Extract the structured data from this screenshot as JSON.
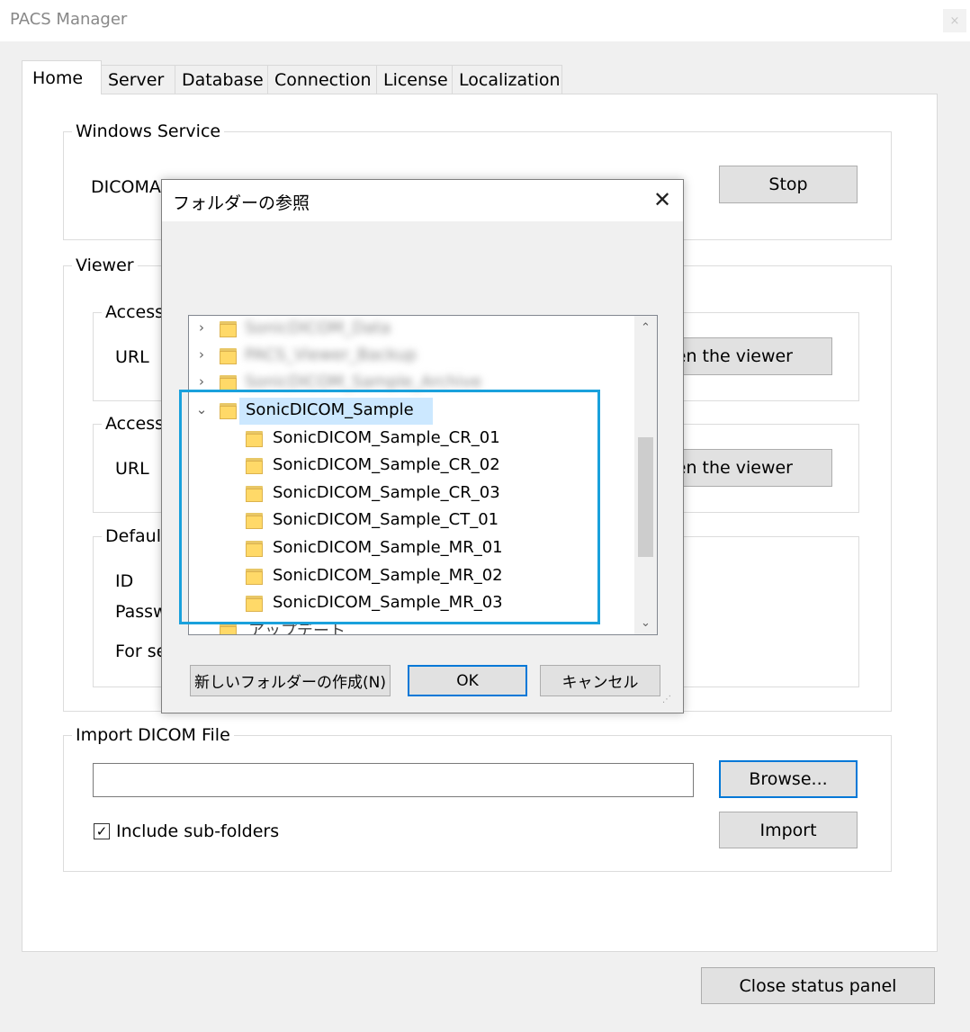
{
  "window": {
    "title": "PACS Manager",
    "close_glyph": "×"
  },
  "tabs": [
    {
      "label": "Home",
      "active": true
    },
    {
      "label": "Server"
    },
    {
      "label": "Database"
    },
    {
      "label": "Connection"
    },
    {
      "label": "License"
    },
    {
      "label": "Localization"
    }
  ],
  "windows_service": {
    "legend": "Windows Service",
    "status_text": "DICOMA",
    "stop_button": "Stop"
  },
  "viewer": {
    "legend": "Viewer",
    "access1": {
      "legend": "Access",
      "url_label": "URL",
      "open_button": "en the viewer"
    },
    "access2": {
      "legend": "Access",
      "url_label": "URL",
      "open_button": "en the viewer"
    },
    "defaults": {
      "legend": "Default",
      "id_label": "ID",
      "password_label": "Passw",
      "for_label": "For se"
    }
  },
  "import": {
    "legend": "Import DICOM File",
    "path_value": "",
    "browse_button": "Browse...",
    "include_subfolders_label": "Include sub-folders",
    "include_subfolders_checked": true,
    "check_glyph": "✓",
    "import_button": "Import"
  },
  "close_status_button": "Close status panel",
  "dialog": {
    "title": "フォルダーの参照",
    "close_glyph": "✕",
    "tree": {
      "blurred_items": [
        "SonicDICOM_Data",
        "PACS_Viewer_Backup",
        "SonicDICOM_Sample_Archive"
      ],
      "selected_folder": "SonicDICOM_Sample",
      "children": [
        "SonicDICOM_Sample_CR_01",
        "SonicDICOM_Sample_CR_02",
        "SonicDICOM_Sample_CR_03",
        "SonicDICOM_Sample_CT_01",
        "SonicDICOM_Sample_MR_01",
        "SonicDICOM_Sample_MR_02",
        "SonicDICOM_Sample_MR_03"
      ],
      "partial_item": "アップデート",
      "collapsed_glyph": "›",
      "expanded_glyph": "⌄",
      "scroll_up_glyph": "⌃",
      "scroll_down_glyph": "⌄"
    },
    "new_folder_button": "新しいフォルダーの作成(N)",
    "ok_button": "OK",
    "cancel_button": "キャンセル",
    "resize_grip": "⋰"
  },
  "colors": {
    "highlight_box": "#1aa1dc",
    "selection": "#cce8ff",
    "focus_border": "#0078d7",
    "folder_icon": "#ffd968"
  }
}
